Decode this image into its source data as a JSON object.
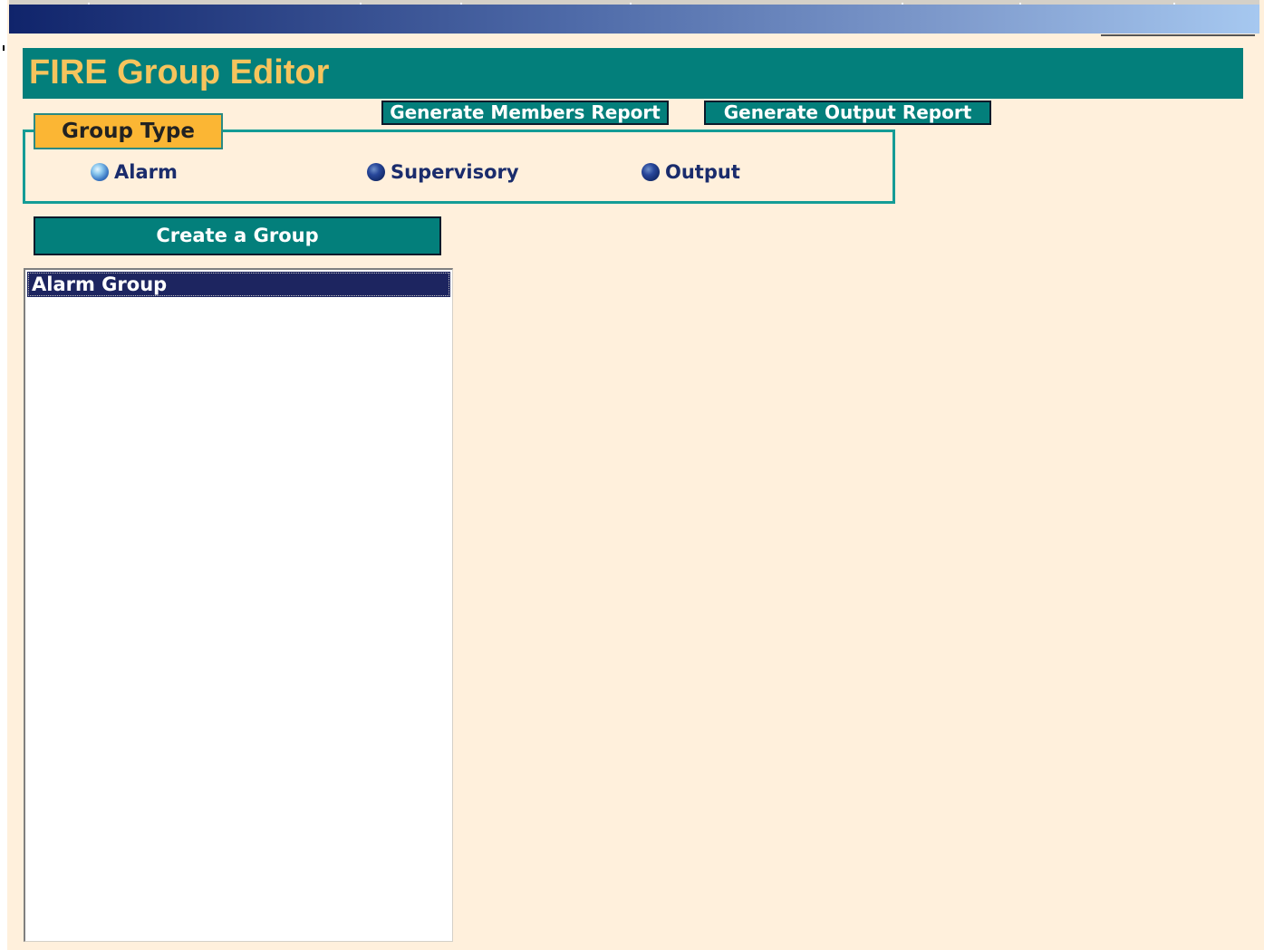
{
  "app": {
    "title": "FIRE Group Editor"
  },
  "toolbar": {
    "members_report_label": "Generate Members Report",
    "output_report_label": "Generate Output Report"
  },
  "group_type": {
    "legend": "Group Type",
    "options": [
      {
        "label": "Alarm",
        "selected": true
      },
      {
        "label": "Supervisory",
        "selected": false
      },
      {
        "label": "Output",
        "selected": false
      }
    ]
  },
  "actions": {
    "create_group_label": "Create a Group"
  },
  "groups": {
    "items": [
      {
        "label": "Alarm Group",
        "selected": true
      }
    ]
  },
  "colors": {
    "header_bg": "#037f7b",
    "title_text": "#f6c45d",
    "legend_bg": "#fbb634",
    "page_bg": "#fff0dc",
    "selection_bg": "#1d2560"
  }
}
